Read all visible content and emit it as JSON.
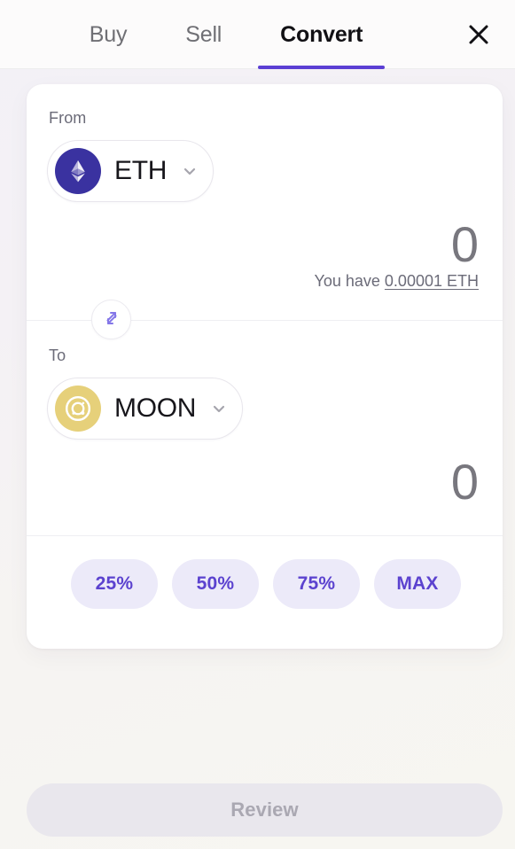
{
  "header": {
    "tabs": [
      {
        "label": "Buy",
        "active": false
      },
      {
        "label": "Sell",
        "active": false
      },
      {
        "label": "Convert",
        "active": true
      }
    ],
    "close_icon": "close-icon",
    "active_underline_color": "#5b3fd4"
  },
  "convert": {
    "from": {
      "label": "From",
      "token_symbol": "ETH",
      "token_icon": "ethereum-icon",
      "token_icon_color": "#3a32a0",
      "chevron_icon": "chevron-down-icon",
      "amount": "0",
      "amount_placeholder": "0",
      "balance_prefix": "You have",
      "balance_value": "0.00001 ETH"
    },
    "swap": {
      "icon": "swap-arrows-icon",
      "icon_color": "#8477e8"
    },
    "to": {
      "label": "To",
      "token_symbol": "MOON",
      "token_icon": "moon-coin-icon",
      "token_icon_color": "#e6d07a",
      "chevron_icon": "chevron-down-icon",
      "amount": "0",
      "amount_placeholder": "0"
    },
    "quick_amounts": [
      {
        "label": "25%"
      },
      {
        "label": "50%"
      },
      {
        "label": "75%"
      },
      {
        "label": "MAX"
      }
    ],
    "quick_amount_bg": "#eceaf9",
    "quick_amount_color": "#5b42cf"
  },
  "footer": {
    "review_label": "Review",
    "review_enabled": false
  }
}
